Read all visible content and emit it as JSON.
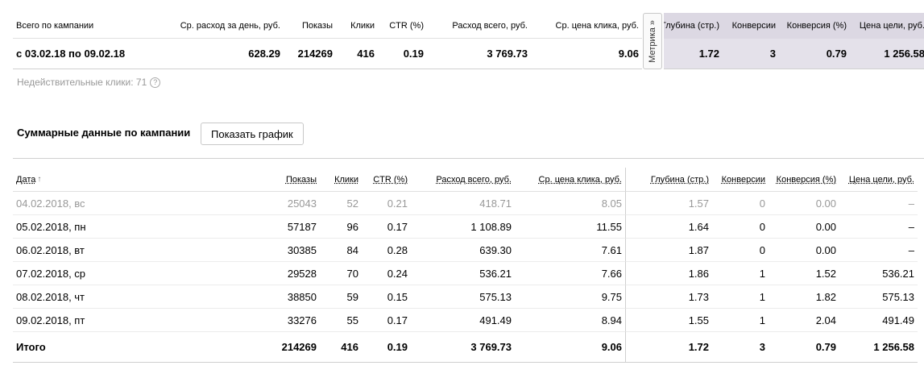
{
  "summary": {
    "headers": [
      "Всего по кампании",
      "Ср. расход за день, руб.",
      "Показы",
      "Клики",
      "CTR (%)",
      "Расход всего, руб.",
      "Ср. цена клика, руб.",
      "Глубина (стр.)",
      "Конверсии",
      "Конверсия (%)",
      "Цена цели, руб."
    ],
    "row": [
      "с 03.02.18 по 09.02.18",
      "628.29",
      "214269",
      "416",
      "0.19",
      "3 769.73",
      "9.06",
      "1.72",
      "3",
      "0.79",
      "1 256.58"
    ]
  },
  "metrika_tab": {
    "label": "Метрика »"
  },
  "invalid_clicks": {
    "label": "Недействительные клики: 71",
    "icon": "question-icon"
  },
  "section": {
    "title": "Суммарные данные по кампании",
    "show_graph_button": "Показать график"
  },
  "daily": {
    "headers": [
      "Дата",
      "Показы",
      "Клики",
      "CTR (%)",
      "Расход всего, руб.",
      "Ср. цена клика, руб.",
      "Глубина (стр.)",
      "Конверсии",
      "Конверсия (%)",
      "Цена цели, руб."
    ],
    "sort_arrow": "↑",
    "rows": [
      [
        "04.02.2018, вс",
        "25043",
        "52",
        "0.21",
        "418.71",
        "8.05",
        "1.57",
        "0",
        "0.00",
        "–"
      ],
      [
        "05.02.2018, пн",
        "57187",
        "96",
        "0.17",
        "1 108.89",
        "11.55",
        "1.64",
        "0",
        "0.00",
        "–"
      ],
      [
        "06.02.2018, вт",
        "30385",
        "84",
        "0.28",
        "639.30",
        "7.61",
        "1.87",
        "0",
        "0.00",
        "–"
      ],
      [
        "07.02.2018, ср",
        "29528",
        "70",
        "0.24",
        "536.21",
        "7.66",
        "1.86",
        "1",
        "1.52",
        "536.21"
      ],
      [
        "08.02.2018, чт",
        "38850",
        "59",
        "0.15",
        "575.13",
        "9.75",
        "1.73",
        "1",
        "1.82",
        "575.13"
      ],
      [
        "09.02.2018, пт",
        "33276",
        "55",
        "0.17",
        "491.49",
        "8.94",
        "1.55",
        "1",
        "2.04",
        "491.49"
      ]
    ],
    "total": [
      "Итого",
      "214269",
      "416",
      "0.19",
      "3 769.73",
      "9.06",
      "1.72",
      "3",
      "0.79",
      "1 256.58"
    ]
  },
  "colors": {
    "metrika_header_bg": "#dcd8e3",
    "metrika_cell_bg": "#e4e1ea",
    "muted_text": "#999999"
  }
}
